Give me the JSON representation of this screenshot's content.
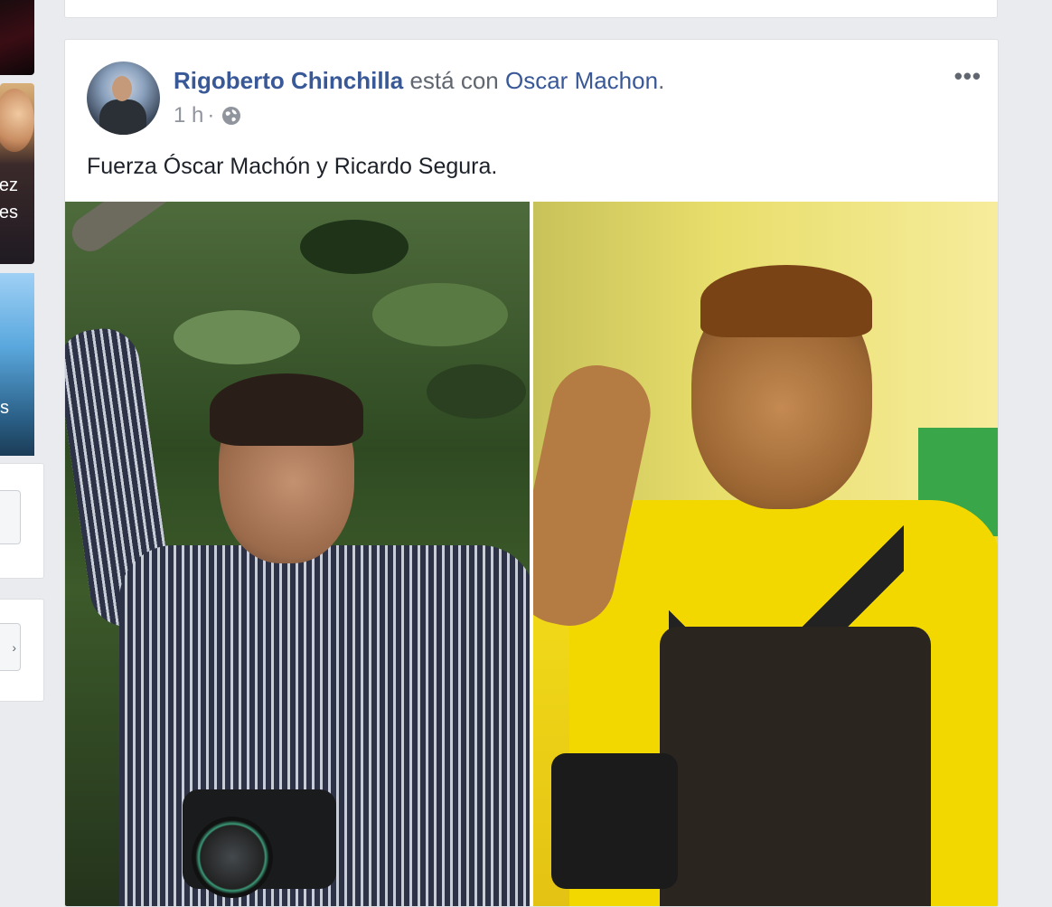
{
  "sidebar": {
    "thumb_lines": [
      "ez",
      "es"
    ],
    "thumb2_line": "s",
    "button_glyph": "›"
  },
  "post": {
    "author": "Rigoberto Chinchilla",
    "with_text": "está con",
    "tagged": "Oscar Machon",
    "time": "1 h",
    "separator": "·",
    "more_label": "•••",
    "text": "Fuerza Óscar Machón y Ricardo Segura.",
    "privacy_icon": "globe-icon",
    "photos": [
      {
        "subject": "photo-left"
      },
      {
        "subject": "photo-right"
      }
    ]
  },
  "colors": {
    "link": "#385898",
    "background": "#e9ebee",
    "meta_text": "#90949c"
  }
}
